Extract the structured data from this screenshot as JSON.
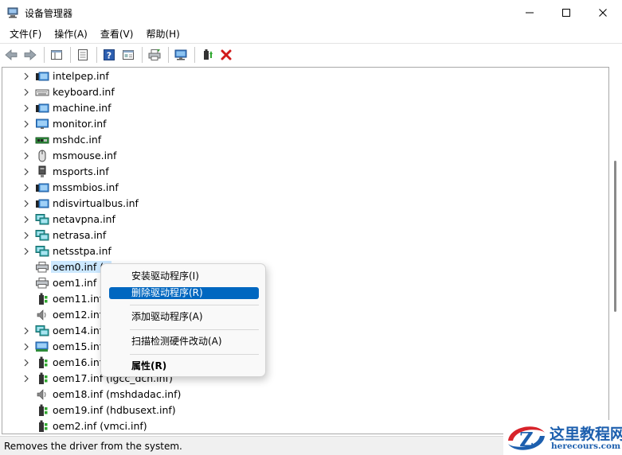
{
  "window": {
    "title": "设备管理器",
    "controls": {
      "minimize": "─",
      "maximize": "☐",
      "close": "✕"
    }
  },
  "menu": [
    "文件(F)",
    "操作(A)",
    "查看(V)",
    "帮助(H)"
  ],
  "toolbar": {
    "buttons": [
      "back-icon",
      "forward-icon",
      "show-hide-tree-icon",
      "properties-icon",
      "help-icon",
      "view-icon",
      "print-icon",
      "scan-hardware-icon",
      "update-driver-icon",
      "uninstall-icon"
    ]
  },
  "tree": {
    "items": [
      {
        "label": "intelpep.inf",
        "icon": "system-device-icon",
        "expander": true
      },
      {
        "label": "keyboard.inf",
        "icon": "keyboard-icon",
        "expander": true
      },
      {
        "label": "machine.inf",
        "icon": "system-device-icon",
        "expander": true
      },
      {
        "label": "monitor.inf",
        "icon": "monitor-icon",
        "expander": true
      },
      {
        "label": "mshdc.inf",
        "icon": "disk-controller-icon",
        "expander": true
      },
      {
        "label": "msmouse.inf",
        "icon": "mouse-icon",
        "expander": true
      },
      {
        "label": "msports.inf",
        "icon": "port-icon",
        "expander": true
      },
      {
        "label": "mssmbios.inf",
        "icon": "system-device-icon",
        "expander": true
      },
      {
        "label": "ndisvirtualbus.inf",
        "icon": "system-device-icon",
        "expander": true
      },
      {
        "label": "netavpna.inf",
        "icon": "network-icon",
        "expander": true
      },
      {
        "label": "netrasa.inf",
        "icon": "network-icon",
        "expander": true
      },
      {
        "label": "netsstpa.inf",
        "icon": "network-icon",
        "expander": true
      },
      {
        "label": "oem0.inf (p",
        "icon": "printer-icon",
        "expander": false,
        "selected": true
      },
      {
        "label": "oem1.inf (p",
        "icon": "printer-icon",
        "expander": false
      },
      {
        "label": "oem11.inf",
        "icon": "usb-device-icon",
        "expander": false
      },
      {
        "label": "oem12.inf",
        "icon": "speaker-icon",
        "expander": false
      },
      {
        "label": "oem14.inf",
        "icon": "network-icon",
        "expander": true
      },
      {
        "label": "oem15.inf",
        "icon": "display-adapter-icon",
        "expander": true
      },
      {
        "label": "oem16.inf",
        "icon": "usb-device-icon",
        "expander": true
      },
      {
        "label": "oem17.inf (igcc_dch.inf)",
        "icon": "usb-device-icon",
        "expander": true
      },
      {
        "label": "oem18.inf (mshdadac.inf)",
        "icon": "speaker-icon",
        "expander": false
      },
      {
        "label": "oem19.inf (hdbusext.inf)",
        "icon": "usb-device-icon",
        "expander": false
      },
      {
        "label": "oem2.inf (vmci.inf)",
        "icon": "usb-device-icon",
        "expander": false
      }
    ]
  },
  "context_menu": {
    "items": [
      {
        "label": "安装驱动程序(I)",
        "highlighted": false,
        "bold": false
      },
      {
        "label": "删除驱动程序(R)",
        "highlighted": true,
        "bold": false
      },
      {
        "label": "添加驱动程序(A)",
        "highlighted": false,
        "bold": false
      },
      {
        "label": "扫描检测硬件改动(A)",
        "highlighted": false,
        "bold": false
      },
      {
        "label": "属性(R)",
        "highlighted": false,
        "bold": true
      }
    ]
  },
  "status": {
    "text": "Removes the driver from the system."
  },
  "watermark": {
    "cn": "这里教程网",
    "en": "herecours.com"
  },
  "colors": {
    "accent": "#0067c0",
    "selection": "#cce8ff",
    "uninstall_red": "#d11a1a",
    "watermark_blue": "#1d5fae"
  }
}
